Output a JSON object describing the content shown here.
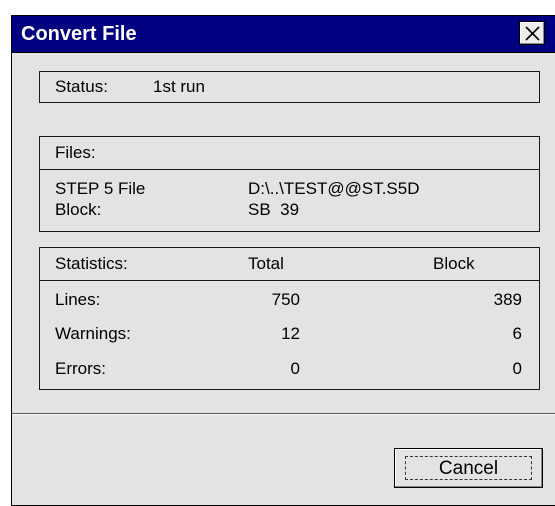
{
  "window": {
    "title": "Convert File",
    "close_icon": "close-icon"
  },
  "status_group": {
    "label": "Status:",
    "value": "1st run"
  },
  "files_group": {
    "header": "Files:",
    "rows": [
      {
        "label": "STEP 5 File",
        "value": "D:\\..\\TEST@@ST.S5D"
      },
      {
        "label": "Block:",
        "value": "SB  39"
      }
    ]
  },
  "statistics_group": {
    "header": "Statistics:",
    "col_total": "Total",
    "col_block": "Block",
    "rows": [
      {
        "label": "Lines:",
        "total": "750",
        "block": "389"
      },
      {
        "label": "Warnings:",
        "total": "12",
        "block": "6"
      },
      {
        "label": "Errors:",
        "total": "0",
        "block": "0"
      }
    ]
  },
  "buttons": {
    "cancel": "Cancel"
  },
  "colors": {
    "titlebar": "#000080",
    "dialog_bg": "#e3e3e3"
  }
}
